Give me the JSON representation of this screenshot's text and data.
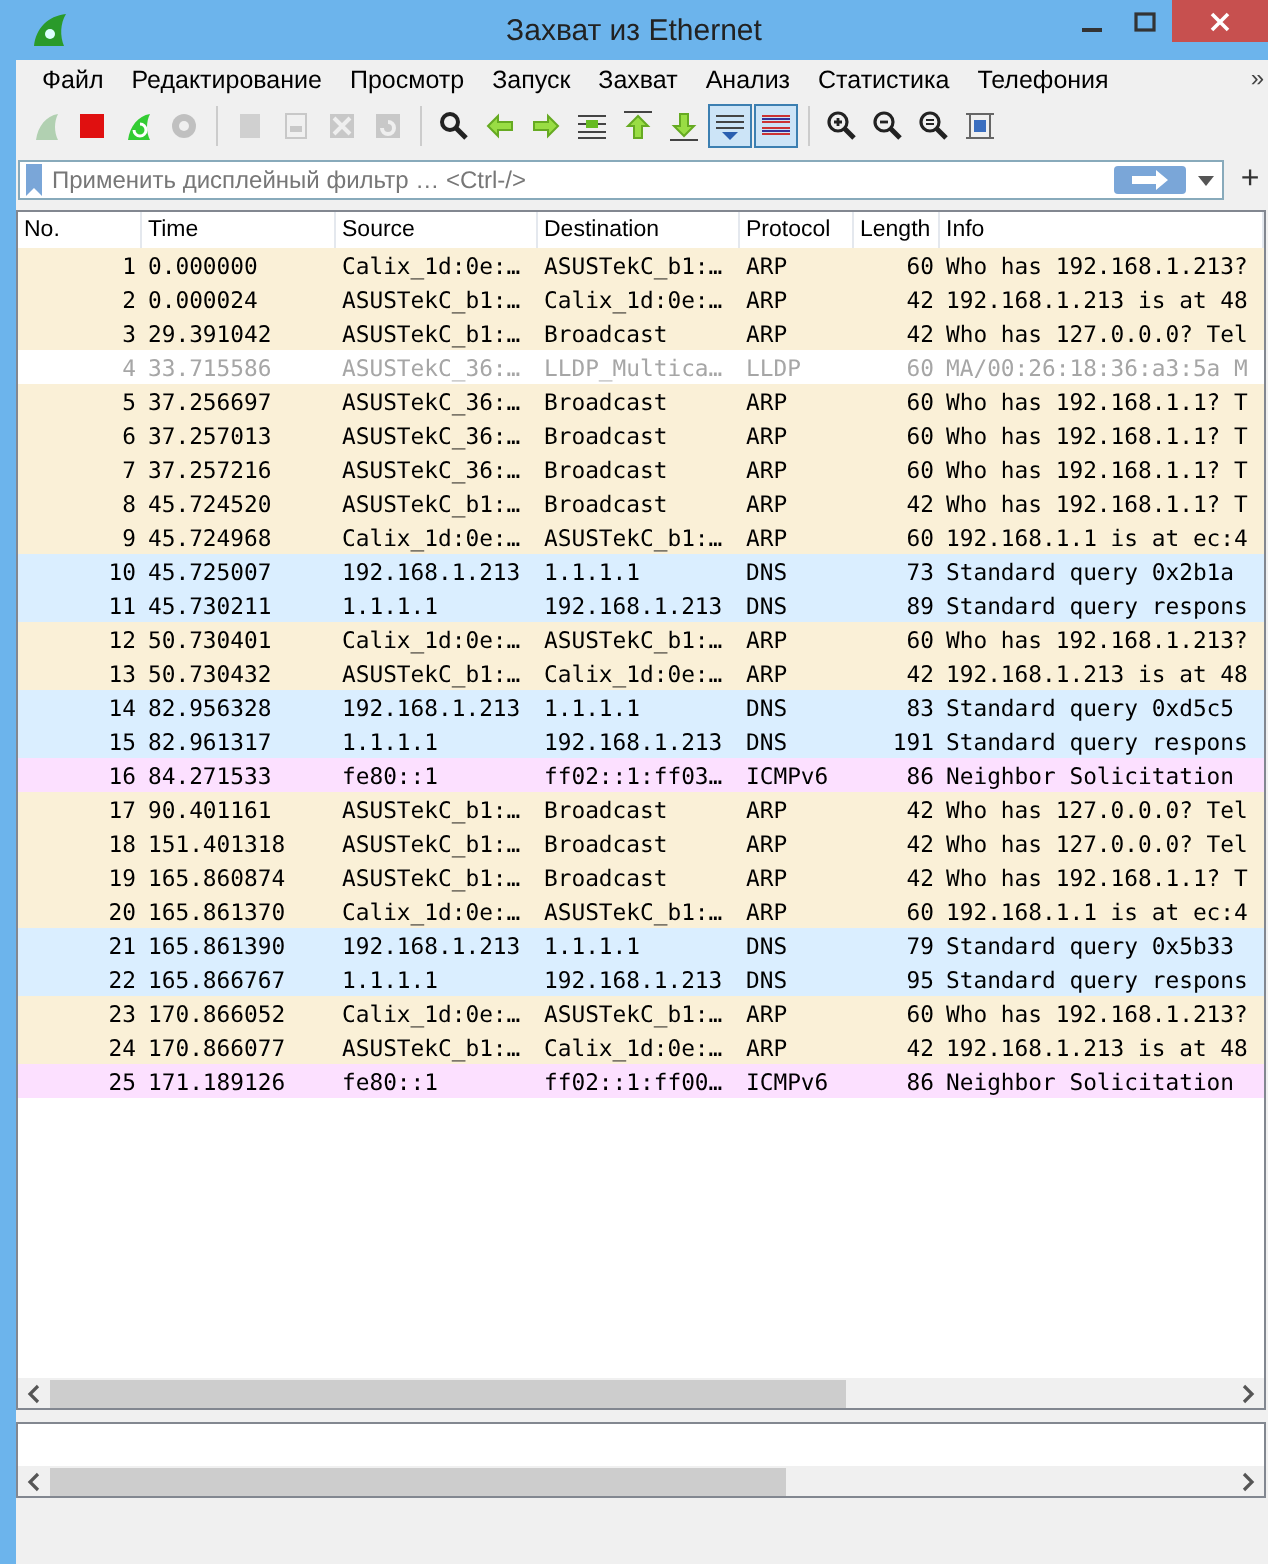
{
  "window": {
    "title": "Захват из Ethernet"
  },
  "menu": [
    "Файл",
    "Редактирование",
    "Просмотр",
    "Запуск",
    "Захват",
    "Анализ",
    "Статистика",
    "Телефония"
  ],
  "menu_overflow": "»",
  "toolbar": [
    {
      "kind": "start",
      "disabled": true,
      "pressed": false
    },
    {
      "kind": "stop",
      "disabled": false,
      "pressed": false
    },
    {
      "kind": "restart",
      "disabled": false,
      "pressed": false
    },
    {
      "kind": "options",
      "disabled": true,
      "pressed": false
    },
    {
      "kind": "sep"
    },
    {
      "kind": "open",
      "disabled": true,
      "pressed": false
    },
    {
      "kind": "save",
      "disabled": true,
      "pressed": false
    },
    {
      "kind": "close",
      "disabled": true,
      "pressed": false
    },
    {
      "kind": "reload",
      "disabled": true,
      "pressed": false
    },
    {
      "kind": "sep"
    },
    {
      "kind": "find",
      "disabled": false,
      "pressed": false
    },
    {
      "kind": "back",
      "disabled": false,
      "pressed": false
    },
    {
      "kind": "forward",
      "disabled": false,
      "pressed": false
    },
    {
      "kind": "goto",
      "disabled": false,
      "pressed": false
    },
    {
      "kind": "first",
      "disabled": false,
      "pressed": false
    },
    {
      "kind": "last",
      "disabled": false,
      "pressed": false
    },
    {
      "kind": "autoscroll",
      "disabled": false,
      "pressed": true
    },
    {
      "kind": "colorize",
      "disabled": false,
      "pressed": true
    },
    {
      "kind": "sep"
    },
    {
      "kind": "zoomin",
      "disabled": false,
      "pressed": false
    },
    {
      "kind": "zoomout",
      "disabled": false,
      "pressed": false
    },
    {
      "kind": "zoomreset",
      "disabled": false,
      "pressed": false
    },
    {
      "kind": "resize",
      "disabled": false,
      "pressed": false
    }
  ],
  "filter": {
    "placeholder": "Применить дисплейный фильтр … <Ctrl-/>",
    "add_label": "+"
  },
  "table": {
    "columns": [
      "No.",
      "Time",
      "Source",
      "Destination",
      "Protocol",
      "Length",
      "Info"
    ],
    "rows": [
      {
        "cells": [
          "1",
          "0.000000",
          "Calix_1d:0e:…",
          "ASUSTekC_b1:…",
          "ARP",
          "60",
          "Who has 192.168.1.213?"
        ],
        "color": "#faf0d7",
        "ignored": false
      },
      {
        "cells": [
          "2",
          "0.000024",
          "ASUSTekC_b1:…",
          "Calix_1d:0e:…",
          "ARP",
          "42",
          "192.168.1.213 is at 48"
        ],
        "color": "#faf0d7",
        "ignored": false
      },
      {
        "cells": [
          "3",
          "29.391042",
          "ASUSTekC_b1:…",
          "Broadcast",
          "ARP",
          "42",
          "Who has 127.0.0.0? Tel"
        ],
        "color": "#faf0d7",
        "ignored": false
      },
      {
        "cells": [
          "4",
          "33.715586",
          "ASUSTekC_36:…",
          "LLDP_Multica…",
          "LLDP",
          "60",
          "MA/00:26:18:36:a3:5a M"
        ],
        "color": "#ffffff",
        "ignored": true
      },
      {
        "cells": [
          "5",
          "37.256697",
          "ASUSTekC_36:…",
          "Broadcast",
          "ARP",
          "60",
          "Who has 192.168.1.1? T"
        ],
        "color": "#faf0d7",
        "ignored": false
      },
      {
        "cells": [
          "6",
          "37.257013",
          "ASUSTekC_36:…",
          "Broadcast",
          "ARP",
          "60",
          "Who has 192.168.1.1? T"
        ],
        "color": "#faf0d7",
        "ignored": false
      },
      {
        "cells": [
          "7",
          "37.257216",
          "ASUSTekC_36:…",
          "Broadcast",
          "ARP",
          "60",
          "Who has 192.168.1.1? T"
        ],
        "color": "#faf0d7",
        "ignored": false
      },
      {
        "cells": [
          "8",
          "45.724520",
          "ASUSTekC_b1:…",
          "Broadcast",
          "ARP",
          "42",
          "Who has 192.168.1.1? T"
        ],
        "color": "#faf0d7",
        "ignored": false
      },
      {
        "cells": [
          "9",
          "45.724968",
          "Calix_1d:0e:…",
          "ASUSTekC_b1:…",
          "ARP",
          "60",
          "192.168.1.1 is at ec:4"
        ],
        "color": "#faf0d7",
        "ignored": false
      },
      {
        "cells": [
          "10",
          "45.725007",
          "192.168.1.213",
          "1.1.1.1",
          "DNS",
          "73",
          "Standard query 0x2b1a"
        ],
        "color": "#daeeff",
        "ignored": false
      },
      {
        "cells": [
          "11",
          "45.730211",
          "1.1.1.1",
          "192.168.1.213",
          "DNS",
          "89",
          "Standard query respons"
        ],
        "color": "#daeeff",
        "ignored": false
      },
      {
        "cells": [
          "12",
          "50.730401",
          "Calix_1d:0e:…",
          "ASUSTekC_b1:…",
          "ARP",
          "60",
          "Who has 192.168.1.213?"
        ],
        "color": "#faf0d7",
        "ignored": false
      },
      {
        "cells": [
          "13",
          "50.730432",
          "ASUSTekC_b1:…",
          "Calix_1d:0e:…",
          "ARP",
          "42",
          "192.168.1.213 is at 48"
        ],
        "color": "#faf0d7",
        "ignored": false
      },
      {
        "cells": [
          "14",
          "82.956328",
          "192.168.1.213",
          "1.1.1.1",
          "DNS",
          "83",
          "Standard query 0xd5c5"
        ],
        "color": "#daeeff",
        "ignored": false
      },
      {
        "cells": [
          "15",
          "82.961317",
          "1.1.1.1",
          "192.168.1.213",
          "DNS",
          "191",
          "Standard query respons"
        ],
        "color": "#daeeff",
        "ignored": false
      },
      {
        "cells": [
          "16",
          "84.271533",
          "fe80::1",
          "ff02::1:ff03…",
          "ICMPv6",
          "86",
          "Neighbor Solicitation"
        ],
        "color": "#fce0ff",
        "ignored": false
      },
      {
        "cells": [
          "17",
          "90.401161",
          "ASUSTekC_b1:…",
          "Broadcast",
          "ARP",
          "42",
          "Who has 127.0.0.0? Tel"
        ],
        "color": "#faf0d7",
        "ignored": false
      },
      {
        "cells": [
          "18",
          "151.401318",
          "ASUSTekC_b1:…",
          "Broadcast",
          "ARP",
          "42",
          "Who has 127.0.0.0? Tel"
        ],
        "color": "#faf0d7",
        "ignored": false
      },
      {
        "cells": [
          "19",
          "165.860874",
          "ASUSTekC_b1:…",
          "Broadcast",
          "ARP",
          "42",
          "Who has 192.168.1.1? T"
        ],
        "color": "#faf0d7",
        "ignored": false
      },
      {
        "cells": [
          "20",
          "165.861370",
          "Calix_1d:0e:…",
          "ASUSTekC_b1:…",
          "ARP",
          "60",
          "192.168.1.1 is at ec:4"
        ],
        "color": "#faf0d7",
        "ignored": false
      },
      {
        "cells": [
          "21",
          "165.861390",
          "192.168.1.213",
          "1.1.1.1",
          "DNS",
          "79",
          "Standard query 0x5b33"
        ],
        "color": "#daeeff",
        "ignored": false
      },
      {
        "cells": [
          "22",
          "165.866767",
          "1.1.1.1",
          "192.168.1.213",
          "DNS",
          "95",
          "Standard query respons"
        ],
        "color": "#daeeff",
        "ignored": false
      },
      {
        "cells": [
          "23",
          "170.866052",
          "Calix_1d:0e:…",
          "ASUSTekC_b1:…",
          "ARP",
          "60",
          "Who has 192.168.1.213?"
        ],
        "color": "#faf0d7",
        "ignored": false
      },
      {
        "cells": [
          "24",
          "170.866077",
          "ASUSTekC_b1:…",
          "Calix_1d:0e:…",
          "ARP",
          "42",
          "192.168.1.213 is at 48"
        ],
        "color": "#faf0d7",
        "ignored": false
      },
      {
        "cells": [
          "25",
          "171.189126",
          "fe80::1",
          "ff02::1:ff00…",
          "ICMPv6",
          "86",
          "Neighbor Solicitation"
        ],
        "color": "#fce0ff",
        "ignored": false
      }
    ]
  }
}
